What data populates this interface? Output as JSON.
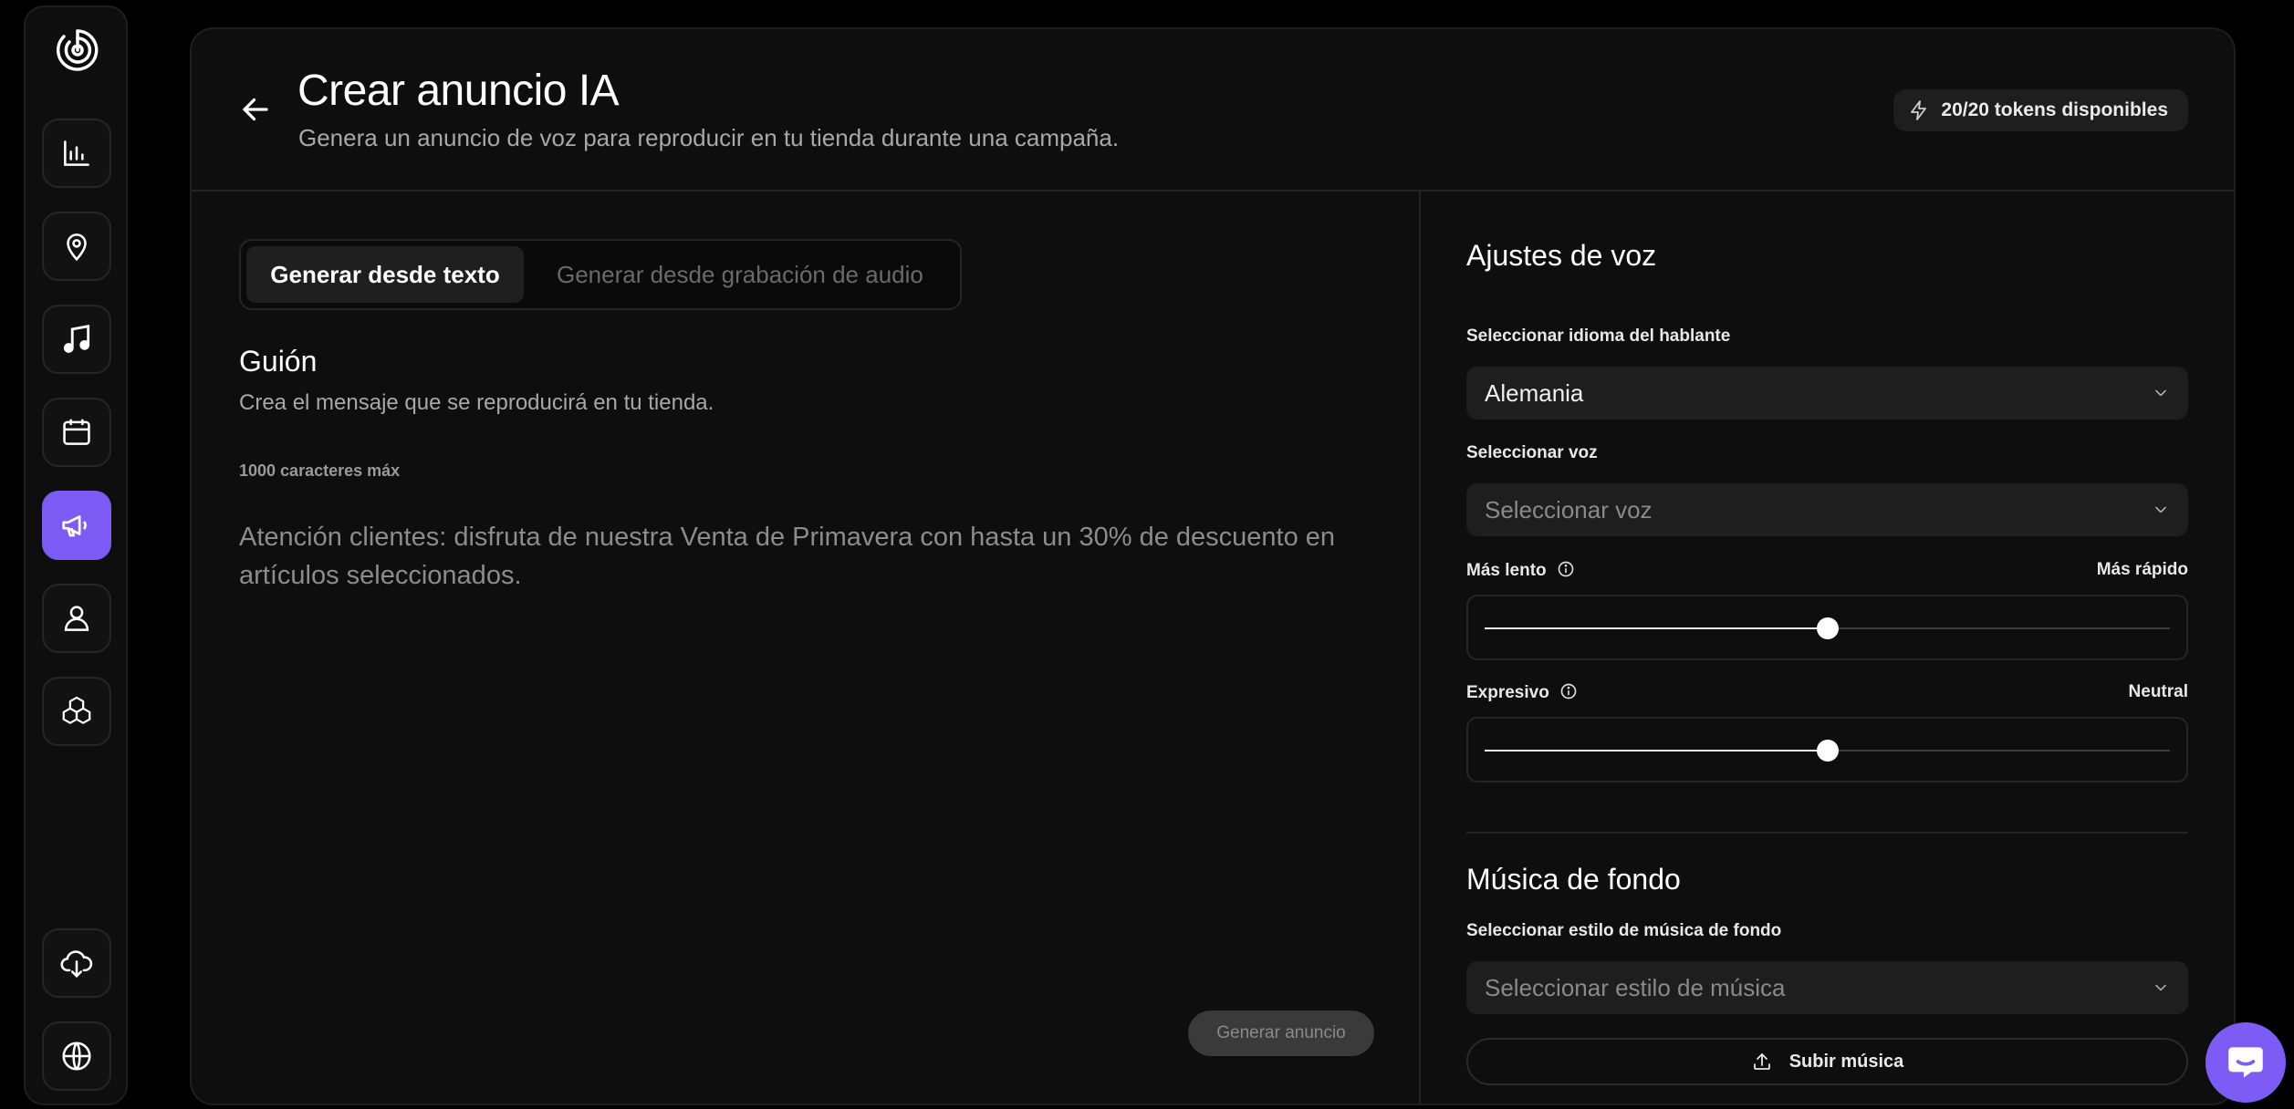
{
  "header": {
    "title": "Crear anuncio IA",
    "subtitle": "Genera un anuncio de voz para reproducir en tu tienda durante una campaña.",
    "tokens": "20/20 tokens disponibles"
  },
  "sidebar": {
    "items": [
      {
        "icon": "bar-chart-icon"
      },
      {
        "icon": "map-pin-icon"
      },
      {
        "icon": "music-note-icon"
      },
      {
        "icon": "calendar-icon"
      },
      {
        "icon": "megaphone-icon",
        "active": true
      },
      {
        "icon": "user-icon"
      },
      {
        "icon": "boxes-icon"
      },
      {
        "icon": "cloud-download-icon"
      },
      {
        "icon": "globe-icon"
      }
    ]
  },
  "tabs": {
    "text": "Generar desde texto",
    "audio": "Generar desde grabación de audio"
  },
  "script": {
    "title": "Guión",
    "subtitle": "Crea el mensaje que se reproducirá en tu tienda.",
    "char_limit": "1000 caracteres máx",
    "text": "Atención clientes: disfruta de nuestra Venta de Primavera con hasta un 30% de descuento en artículos seleccionados.",
    "generate_label": "Generar anuncio"
  },
  "voice": {
    "title": "Ajustes de voz",
    "language_label": "Seleccionar idioma del hablante",
    "language_value": "Alemania",
    "voice_label": "Seleccionar voz",
    "voice_placeholder": "Seleccionar voz",
    "speed_left": "Más lento",
    "speed_right": "Más rápido",
    "speed_value": 0.5,
    "style_left": "Expresivo",
    "style_right": "Neutral",
    "style_value": 0.5
  },
  "music": {
    "title": "Música de fondo",
    "style_label": "Seleccionar estilo de música de fondo",
    "style_placeholder": "Seleccionar estilo de música",
    "upload_label": "Subir música"
  },
  "colors": {
    "accent": "#7c5cf5",
    "background": "#000000",
    "panel": "#0e0e0e"
  }
}
